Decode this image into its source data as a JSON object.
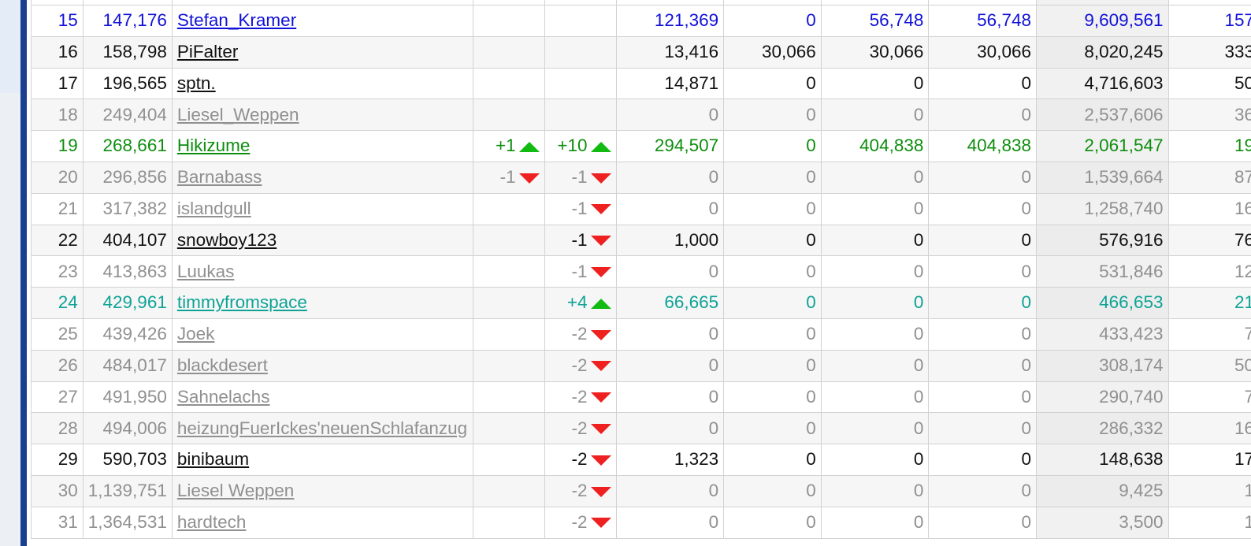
{
  "colors": {
    "blue": "#1111d8",
    "black": "#111111",
    "grey": "#909090",
    "green": "#0e8e0e",
    "teal": "#0ea396",
    "up_arrow": "#12bb12",
    "down_arrow": "#ee2020",
    "nav_bar": "#1a3f8f"
  },
  "rows": [
    {
      "rank": "15",
      "score": "147,176",
      "name": "Stefan_Kramer",
      "change1": "",
      "dir1": "",
      "change2": "",
      "dir2": "",
      "c5": "121,369",
      "c6": "0",
      "c7": "56,748",
      "c8": "56,748",
      "total": "9,609,561",
      "last": "157",
      "style": "blue"
    },
    {
      "rank": "16",
      "score": "158,798",
      "name": "PiFalter",
      "change1": "",
      "dir1": "",
      "change2": "",
      "dir2": "",
      "c5": "13,416",
      "c6": "30,066",
      "c7": "30,066",
      "c8": "30,066",
      "total": "8,020,245",
      "last": "333",
      "style": "black"
    },
    {
      "rank": "17",
      "score": "196,565",
      "name": "sptn.",
      "change1": "",
      "dir1": "",
      "change2": "",
      "dir2": "",
      "c5": "14,871",
      "c6": "0",
      "c7": "0",
      "c8": "0",
      "total": "4,716,603",
      "last": "50",
      "style": "black"
    },
    {
      "rank": "18",
      "score": "249,404",
      "name": "Liesel_Weppen",
      "change1": "",
      "dir1": "",
      "change2": "",
      "dir2": "",
      "c5": "0",
      "c6": "0",
      "c7": "0",
      "c8": "0",
      "total": "2,537,606",
      "last": "36",
      "style": "grey"
    },
    {
      "rank": "19",
      "score": "268,661",
      "name": "Hikizume",
      "change1": "+1",
      "dir1": "up",
      "change2": "+10",
      "dir2": "up",
      "c5": "294,507",
      "c6": "0",
      "c7": "404,838",
      "c8": "404,838",
      "total": "2,061,547",
      "last": "19",
      "style": "green"
    },
    {
      "rank": "20",
      "score": "296,856",
      "name": "Barnabass",
      "change1": "-1",
      "dir1": "down",
      "change2": "-1",
      "dir2": "down",
      "c5": "0",
      "c6": "0",
      "c7": "0",
      "c8": "0",
      "total": "1,539,664",
      "last": "87",
      "style": "grey"
    },
    {
      "rank": "21",
      "score": "317,382",
      "name": "islandgull",
      "change1": "",
      "dir1": "",
      "change2": "-1",
      "dir2": "down",
      "c5": "0",
      "c6": "0",
      "c7": "0",
      "c8": "0",
      "total": "1,258,740",
      "last": "16",
      "style": "grey"
    },
    {
      "rank": "22",
      "score": "404,107",
      "name": "snowboy123",
      "change1": "",
      "dir1": "",
      "change2": "-1",
      "dir2": "down",
      "c5": "1,000",
      "c6": "0",
      "c7": "0",
      "c8": "0",
      "total": "576,916",
      "last": "76",
      "style": "black"
    },
    {
      "rank": "23",
      "score": "413,863",
      "name": "Luukas",
      "change1": "",
      "dir1": "",
      "change2": "-1",
      "dir2": "down",
      "c5": "0",
      "c6": "0",
      "c7": "0",
      "c8": "0",
      "total": "531,846",
      "last": "12",
      "style": "grey"
    },
    {
      "rank": "24",
      "score": "429,961",
      "name": "timmyfromspace",
      "change1": "",
      "dir1": "",
      "change2": "+4",
      "dir2": "up",
      "c5": "66,665",
      "c6": "0",
      "c7": "0",
      "c8": "0",
      "total": "466,653",
      "last": "21",
      "style": "teal"
    },
    {
      "rank": "25",
      "score": "439,426",
      "name": "Joek",
      "change1": "",
      "dir1": "",
      "change2": "-2",
      "dir2": "down",
      "c5": "0",
      "c6": "0",
      "c7": "0",
      "c8": "0",
      "total": "433,423",
      "last": "7",
      "style": "grey"
    },
    {
      "rank": "26",
      "score": "484,017",
      "name": "blackdesert",
      "change1": "",
      "dir1": "",
      "change2": "-2",
      "dir2": "down",
      "c5": "0",
      "c6": "0",
      "c7": "0",
      "c8": "0",
      "total": "308,174",
      "last": "50",
      "style": "grey"
    },
    {
      "rank": "27",
      "score": "491,950",
      "name": "Sahnelachs",
      "change1": "",
      "dir1": "",
      "change2": "-2",
      "dir2": "down",
      "c5": "0",
      "c6": "0",
      "c7": "0",
      "c8": "0",
      "total": "290,740",
      "last": "7",
      "style": "grey"
    },
    {
      "rank": "28",
      "score": "494,006",
      "name": "heizungFuerIckes'neuenSchlafanzug",
      "change1": "",
      "dir1": "",
      "change2": "-2",
      "dir2": "down",
      "c5": "0",
      "c6": "0",
      "c7": "0",
      "c8": "0",
      "total": "286,332",
      "last": "16",
      "style": "grey"
    },
    {
      "rank": "29",
      "score": "590,703",
      "name": "binibaum",
      "change1": "",
      "dir1": "",
      "change2": "-2",
      "dir2": "down",
      "c5": "1,323",
      "c6": "0",
      "c7": "0",
      "c8": "0",
      "total": "148,638",
      "last": "17",
      "style": "black"
    },
    {
      "rank": "30",
      "score": "1,139,751",
      "name": "Liesel Weppen",
      "change1": "",
      "dir1": "",
      "change2": "-2",
      "dir2": "down",
      "c5": "0",
      "c6": "0",
      "c7": "0",
      "c8": "0",
      "total": "9,425",
      "last": "1",
      "style": "grey"
    },
    {
      "rank": "31",
      "score": "1,364,531",
      "name": "hardtech",
      "change1": "",
      "dir1": "",
      "change2": "-2",
      "dir2": "down",
      "c5": "0",
      "c6": "0",
      "c7": "0",
      "c8": "0",
      "total": "3,500",
      "last": "1",
      "style": "grey"
    }
  ]
}
